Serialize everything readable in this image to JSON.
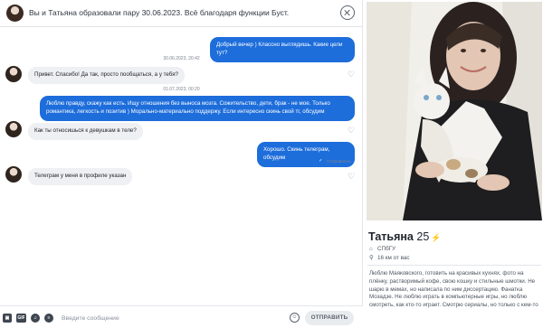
{
  "header": {
    "match_text": "Вы и Татьяна образовали пару 30.06.2023. Всё благодаря функции Буст."
  },
  "messages": {
    "ts1": "30.06.2023, 20:42",
    "m1": "Добрый вечер ) Классно выглядишь. Какие цели тут?",
    "m2": "Привет. Спасибо! Да так, просто пообщаться, а у тебя?",
    "ts2": "01.07.2023, 00:20",
    "m3": "Люблю правду, скажу как есть. Ищу отношения без выноса мозга. Сожительство, дети, брак - не мое. Только романтика, легкость и позитив ) Морально-материально поддержу. Если интересно скинь свой тг, обсудим",
    "m4": "Как ты относишься к девушкам в теле?",
    "m5": "Хорошо. Скинь телеграм, обсудим",
    "status": "Отправлено",
    "m6": "Телеграм у меня в профиле указан"
  },
  "composer": {
    "gif_label": "GIF",
    "placeholder": "Введите сообщение",
    "send_label": "ОТПРАВИТЬ"
  },
  "profile": {
    "name": "Татьяна",
    "age": "25",
    "school": "СПбГУ",
    "distance": "16 км от вас",
    "bio": "Люблю Маяковского, готовить на красивых кухнях, фото на плёнку, растворимый кофе, свою кошку и стильные шмотки. Не шарю в мемах, но написала по ним диссертацию. Фанатка Мозадзе. Не люблю играть в компьютерные игры, но люблю смотреть, как кто-то играет. Смотрю сериалы, но только с кем-то"
  },
  "colors": {
    "accent": "#1d6ddb",
    "bubble_in": "#eef0f3",
    "boost": "#9b4dff"
  },
  "icons": {
    "close": "close-icon",
    "like": "heart-icon",
    "sent": "check-icon",
    "school": "school-icon",
    "location": "location-pin-icon",
    "emoji": "emoji-icon"
  }
}
